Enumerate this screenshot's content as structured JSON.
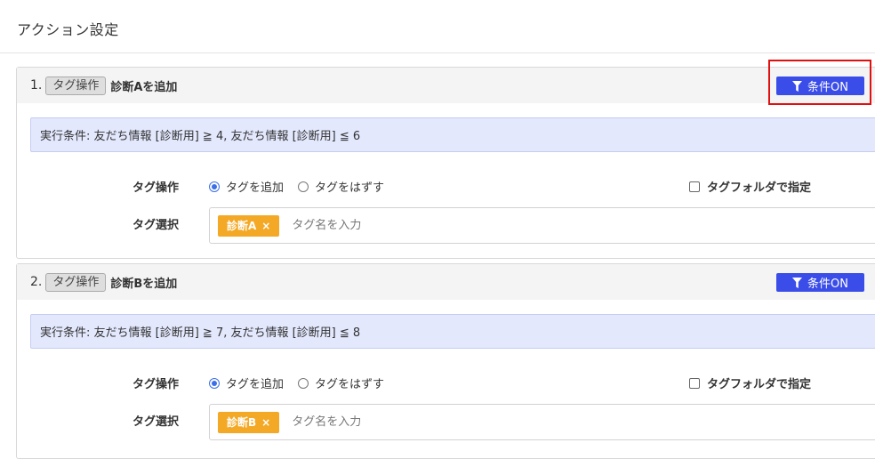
{
  "page": {
    "title": "アクション設定"
  },
  "actions": [
    {
      "number": "1.",
      "badge": "タグ操作",
      "name": "診断Aを追加",
      "condition_button": "条件ON",
      "condition_text": "実行条件: 友だち情報 [診断用] ≧ 4, 友だち情報 [診断用] ≦ 6",
      "op_label": "タグ操作",
      "radio_add": "タグを追加",
      "radio_remove": "タグをはずす",
      "folder_label": "タグフォルダで指定",
      "select_label": "タグ選択",
      "chip": "診断A",
      "chip_remove": "×",
      "placeholder": "タグ名を入力"
    },
    {
      "number": "2.",
      "badge": "タグ操作",
      "name": "診断Bを追加",
      "condition_button": "条件ON",
      "condition_text": "実行条件: 友だち情報 [診断用] ≧ 7, 友だち情報 [診断用] ≦ 8",
      "op_label": "タグ操作",
      "radio_add": "タグを追加",
      "radio_remove": "タグをはずす",
      "folder_label": "タグフォルダで指定",
      "select_label": "タグ選択",
      "chip": "診断B",
      "chip_remove": "×",
      "placeholder": "タグ名を入力"
    }
  ],
  "colors": {
    "accent_button": "#3b4de8",
    "chip": "#f4a926",
    "highlight": "#e01010",
    "condition_bg": "#e3e8fd"
  },
  "icons": {
    "condition_button": "funnel-icon",
    "chip_remove": "close-icon"
  }
}
